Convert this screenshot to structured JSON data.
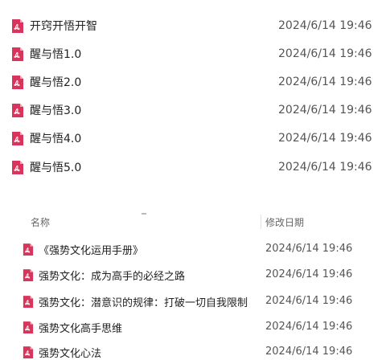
{
  "top_files": [
    {
      "name": "开窍开悟开智",
      "modified": "2024/6/14 19:46"
    },
    {
      "name": "醒与悟1.0",
      "modified": "2024/6/14 19:46"
    },
    {
      "name": "醒与悟2.0",
      "modified": "2024/6/14 19:46"
    },
    {
      "name": "醒与悟3.0",
      "modified": "2024/6/14 19:46"
    },
    {
      "name": "醒与悟4.0",
      "modified": "2024/6/14 19:46"
    },
    {
      "name": "醒与悟5.0",
      "modified": "2024/6/14 19:46"
    }
  ],
  "header": {
    "name": "名称",
    "modified": "修改日期"
  },
  "bottom_files": [
    {
      "name": "《强势文化运用手册》",
      "modified": "2024/6/14 19:46"
    },
    {
      "name": "强势文化：成为高手的必经之路",
      "modified": "2024/6/14 19:46"
    },
    {
      "name": "强势文化：潜意识的规律：打破一切自我限制",
      "modified": "2024/6/14 19:46"
    },
    {
      "name": "强势文化高手思维",
      "modified": "2024/6/14 19:46"
    },
    {
      "name": "强势文化心法",
      "modified": "2024/6/14 19:46"
    }
  ],
  "icon": {
    "name": "pdf-file-icon",
    "color": "#d9345b",
    "fold_color": "#f2a9ba"
  }
}
